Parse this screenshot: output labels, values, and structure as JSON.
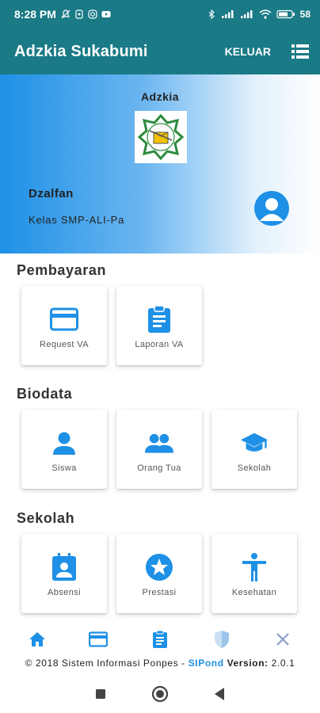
{
  "status_bar": {
    "time": "8:28 PM",
    "battery": "58"
  },
  "app_bar": {
    "title": "Adzkia Sukabumi",
    "logout_label": "KELUAR"
  },
  "profile": {
    "school": "Adzkia",
    "student_name": "Dzalfan",
    "student_class": "Kelas SMP-ALI-Pa"
  },
  "sections": {
    "payment": {
      "title": "Pembayaran",
      "items": [
        {
          "label": "Request VA",
          "icon": "credit-card-icon"
        },
        {
          "label": "Laporan VA",
          "icon": "clipboard-icon"
        }
      ]
    },
    "biodata": {
      "title": "Biodata",
      "items": [
        {
          "label": "Siswa",
          "icon": "person-icon"
        },
        {
          "label": "Orang Tua",
          "icon": "people-icon"
        },
        {
          "label": "Sekolah",
          "icon": "school-icon"
        }
      ]
    },
    "school": {
      "title": "Sekolah",
      "items": [
        {
          "label": "Absensi",
          "icon": "badge-icon"
        },
        {
          "label": "Prestasi",
          "icon": "star-icon"
        },
        {
          "label": "Kesehatan",
          "icon": "accessibility-icon"
        }
      ]
    }
  },
  "bottom_nav": [
    "home-icon",
    "credit-card-icon",
    "clipboard-icon",
    "shield-icon",
    "close-icon"
  ],
  "footer": {
    "prefix": "© 2018 Sistem Informasi Ponpes - ",
    "brand": "SIPond",
    "version_label": " Version:",
    "version": " 2.0.1"
  },
  "colors": {
    "primary": "#1a7a86",
    "accent": "#1e90e6"
  }
}
